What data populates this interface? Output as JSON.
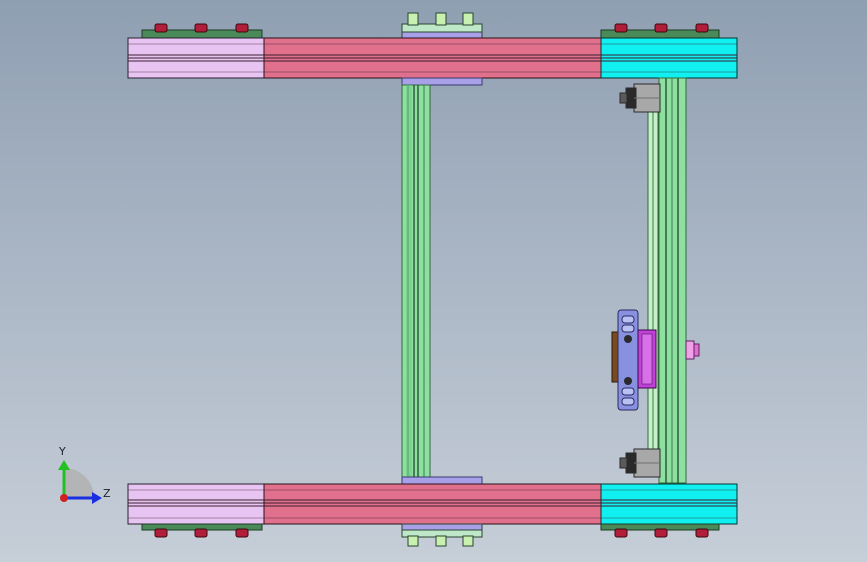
{
  "viewport": {
    "background_top": "#8f9fb2",
    "background_bottom": "#c6ced8"
  },
  "triad": {
    "y_label": "Y",
    "z_label": "Z",
    "y_color": "#22c022",
    "z_color": "#1a2fe0",
    "origin_color": "#d02020"
  },
  "colors": {
    "pink_light": "#e8c4f2",
    "rose": "#e0708c",
    "cyan": "#10f0f0",
    "rail_green": "#8ee0a0",
    "rail_dark": "#3c7a4c",
    "bolt": "#b01e3a",
    "plate_green": "#4a8a58",
    "bracket_blue": "#8890e0",
    "magenta": "#c040d8",
    "brown": "#7a4a20",
    "block_grey": "#a8a8a8"
  }
}
